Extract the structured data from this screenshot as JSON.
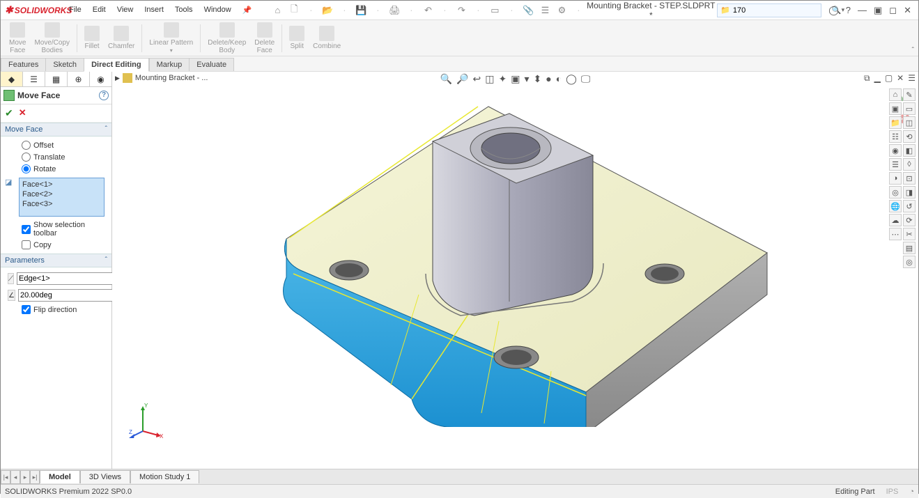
{
  "app": {
    "name": "SOLIDWORKS",
    "title": "Mounting Bracket - STEP.SLDPRT *"
  },
  "menus": [
    "File",
    "Edit",
    "View",
    "Insert",
    "Tools",
    "Window"
  ],
  "search": {
    "value": "170"
  },
  "ribbon": [
    {
      "l1": "Move",
      "l2": "Face"
    },
    {
      "l1": "Move/Copy",
      "l2": "Bodies"
    },
    {
      "l1": "Fillet",
      "l2": ""
    },
    {
      "l1": "Chamfer",
      "l2": ""
    },
    {
      "l1": "Linear Pattern",
      "l2": ""
    },
    {
      "l1": "Delete/Keep",
      "l2": "Body"
    },
    {
      "l1": "Delete",
      "l2": "Face"
    },
    {
      "l1": "Split",
      "l2": ""
    },
    {
      "l1": "Combine",
      "l2": ""
    }
  ],
  "tabs": {
    "items": [
      "Features",
      "Sketch",
      "Direct Editing",
      "Markup",
      "Evaluate"
    ],
    "activeIndex": 2
  },
  "breadcrumb": "Mounting Bracket - ...",
  "pm": {
    "title": "Move Face",
    "section1": "Move Face",
    "options": {
      "offset": "Offset",
      "translate": "Translate",
      "rotate": "Rotate"
    },
    "faces": [
      "Face<1>",
      "Face<2>",
      "Face<3>"
    ],
    "showSelToolbar": "Show selection toolbar",
    "copy": "Copy",
    "section2": "Parameters",
    "edge": "Edge<1>",
    "angle": "20.00deg",
    "flip": "Flip direction"
  },
  "bottomTabs": [
    "Model",
    "3D Views",
    "Motion Study 1"
  ],
  "status": {
    "left": "SOLIDWORKS Premium 2022 SP0.0",
    "right": "Editing Part",
    "units": "IPS"
  }
}
